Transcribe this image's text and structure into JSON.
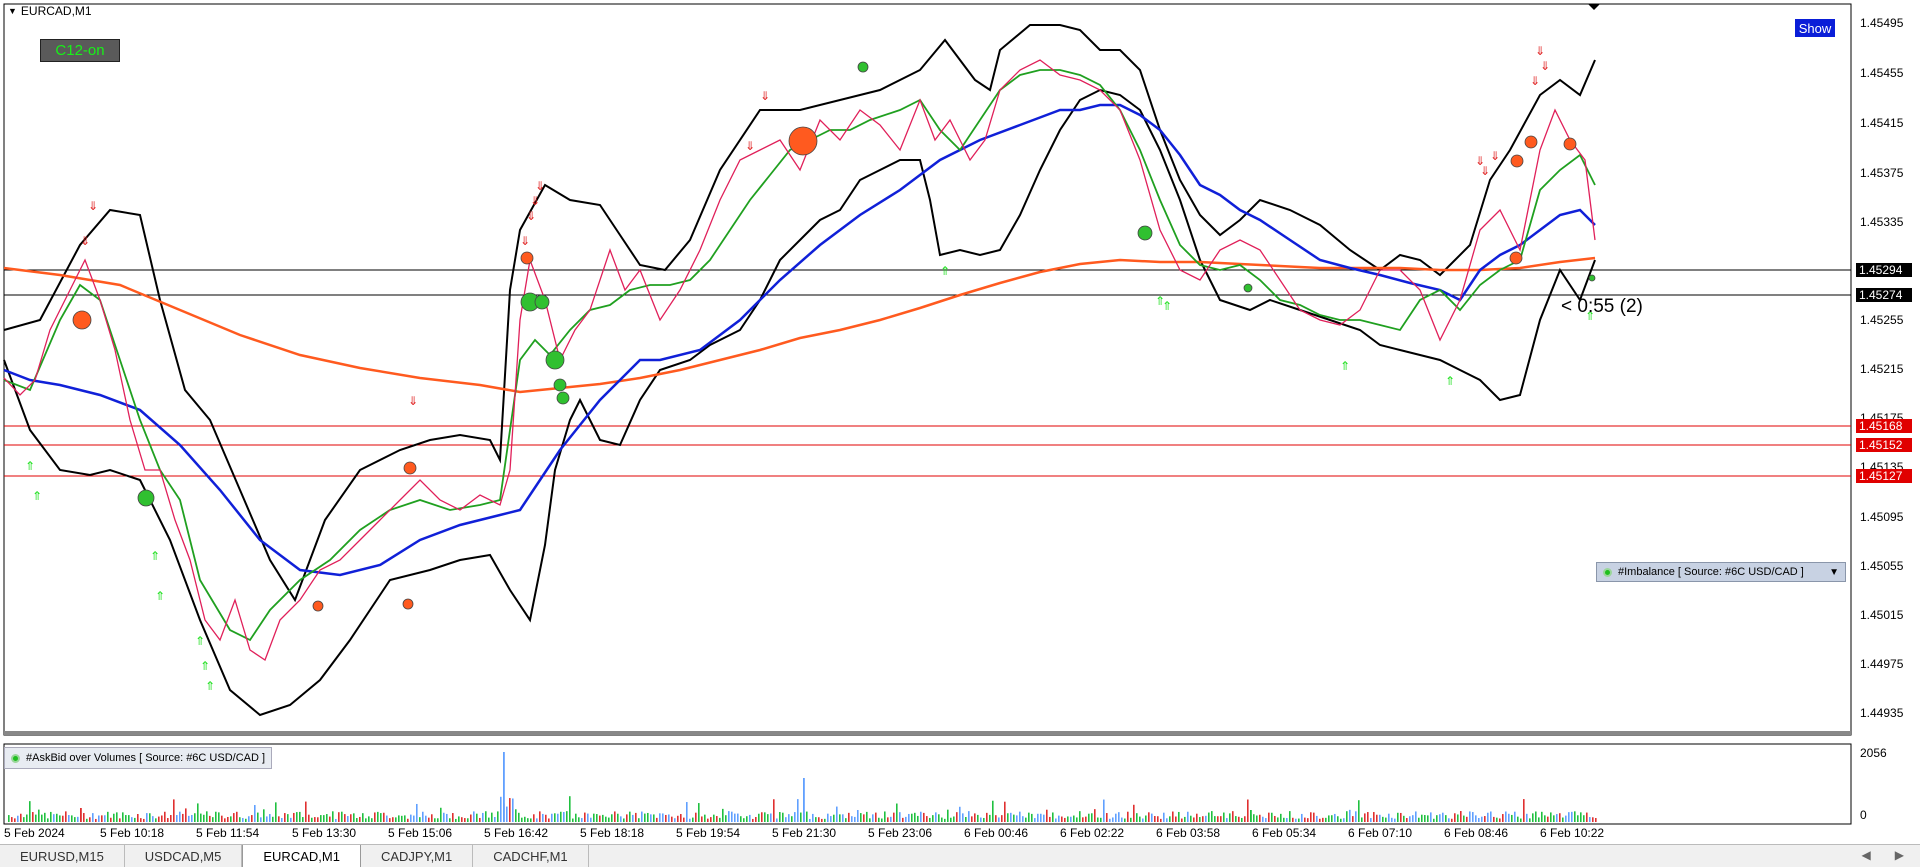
{
  "window": {
    "title": "EURCAD,M1",
    "collapse_icon": "triangle-down-icon"
  },
  "badges": {
    "c12": "C12-on",
    "show": "Show"
  },
  "price_axis": [
    "1.45495",
    "1.45455",
    "1.45415",
    "1.45375",
    "1.45335",
    "1.45255",
    "1.45215",
    "1.45175",
    "1.45135",
    "1.45095",
    "1.45055",
    "1.45015",
    "1.44975",
    "1.44935"
  ],
  "price_tags": [
    {
      "value": "1.45294",
      "style": "black"
    },
    {
      "value": "1.45274",
      "style": "black"
    },
    {
      "value": "1.45168",
      "style": "red"
    },
    {
      "value": "1.45152",
      "style": "red"
    },
    {
      "value": "1.45127",
      "style": "red"
    }
  ],
  "countdown": "< 0:55 (2)",
  "imbalance_indicator": "#Imbalance [ Source: #6C USD/CAD ]",
  "volume_indicator": "#AskBid over Volumes [ Source: #6C USD/CAD ]",
  "volume_scale": {
    "max": "2056",
    "min": "0"
  },
  "time_axis": [
    "5 Feb 2024",
    "5 Feb 10:18",
    "5 Feb 11:54",
    "5 Feb 13:30",
    "5 Feb 15:06",
    "5 Feb 16:42",
    "5 Feb 18:18",
    "5 Feb 19:54",
    "5 Feb 21:30",
    "5 Feb 23:06",
    "6 Feb 00:46",
    "6 Feb 02:22",
    "6 Feb 03:58",
    "6 Feb 05:34",
    "6 Feb 07:10",
    "6 Feb 08:46",
    "6 Feb 10:22"
  ],
  "tabs": [
    {
      "label": "EURUSD,M15",
      "active": false
    },
    {
      "label": "USDCAD,M5",
      "active": false
    },
    {
      "label": "EURCAD,M1",
      "active": true
    },
    {
      "label": "CADJPY,M1",
      "active": false
    },
    {
      "label": "CADCHF,M1",
      "active": false
    }
  ],
  "colors": {
    "bid_line": "#000000",
    "level_lines": "#e00000",
    "ma_slow": "#ff5a1f",
    "ma_mid": "#1020d8",
    "ma_fast": "#20a020",
    "price": "#e0205a",
    "tab_active": "#ffffff"
  }
}
